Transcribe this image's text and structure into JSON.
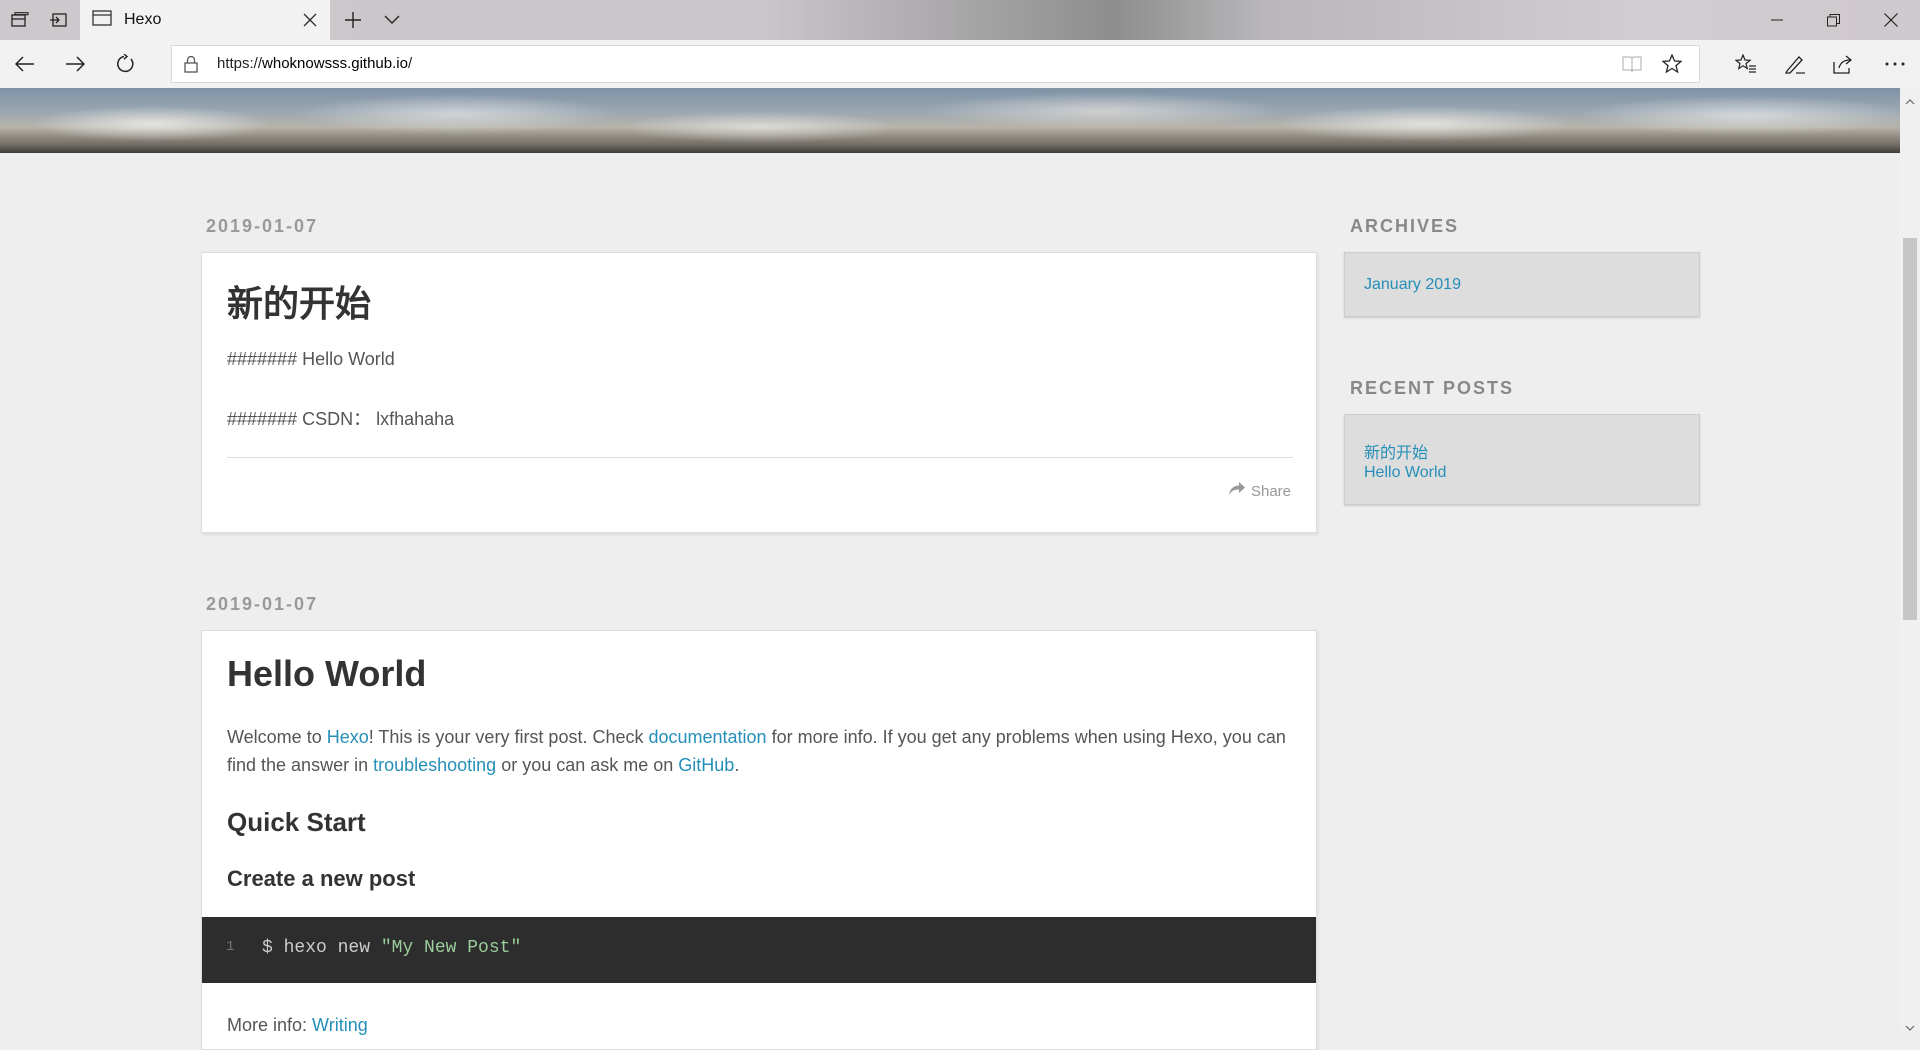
{
  "browser": {
    "tab_title": "Hexo",
    "url_prefix": "https://",
    "url_host": "whoknowsss.github.io",
    "url_path": "/"
  },
  "posts": [
    {
      "date": "2019-01-07",
      "title": "新的开始",
      "lines": [
        "####### Hello World",
        "####### CSDN： lxfhahaha"
      ],
      "share_label": "Share"
    },
    {
      "date": "2019-01-07",
      "title": "Hello World",
      "intro": {
        "t1": "Welcome to ",
        "link1": "Hexo",
        "t2": "! This is your very first post. Check ",
        "link2": "documentation",
        "t3": " for more info. If you get any problems when using Hexo, you can find the answer in ",
        "link3": "troubleshooting",
        "t4": " or you can ask me on ",
        "link4": "GitHub",
        "t5": "."
      },
      "h2": "Quick Start",
      "h3": "Create a new post",
      "code": {
        "line_number": "1",
        "prefix": "$ hexo new ",
        "string": "\"My New Post\""
      },
      "more_label": "More info: ",
      "more_link": "Writing"
    }
  ],
  "sidebar": {
    "archives_title": "ARCHIVES",
    "archives": [
      "January 2019"
    ],
    "recent_title": "RECENT POSTS",
    "recent": [
      "新的开始",
      "Hello World"
    ]
  },
  "colors": {
    "link": "#258fb8",
    "background": "#eeeeee",
    "code_bg": "#2d2d2d"
  }
}
